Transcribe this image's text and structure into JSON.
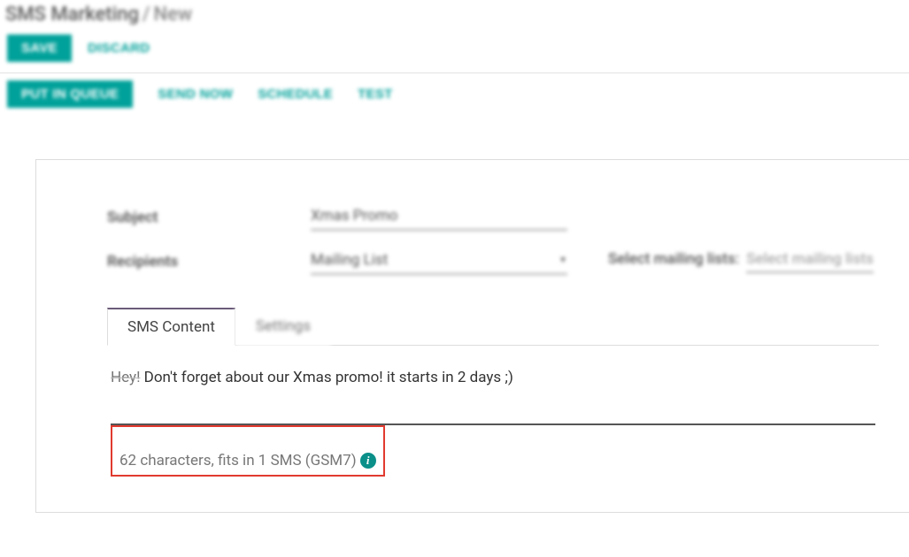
{
  "breadcrumb": {
    "root": "SMS Marketing",
    "current": "New"
  },
  "toolbar1": {
    "save": "SAVE",
    "discard": "DISCARD"
  },
  "toolbar2": {
    "queue": "PUT IN QUEUE",
    "send_now": "SEND NOW",
    "schedule": "SCHEDULE",
    "test": "TEST"
  },
  "form": {
    "subject_label": "Subject",
    "subject_value": "Xmas Promo",
    "recipients_label": "Recipients",
    "recipients_value": "Mailing List",
    "mailing_label": "Select mailing lists:",
    "mailing_placeholder": "Select mailing lists"
  },
  "tabs": {
    "content": "SMS Content",
    "settings": "Settings"
  },
  "sms": {
    "prefix": "Hey!",
    "body": " Don't forget about our Xmas promo! it starts in 2 days ;)",
    "status": "62 characters, fits in 1 SMS (GSM7)"
  }
}
